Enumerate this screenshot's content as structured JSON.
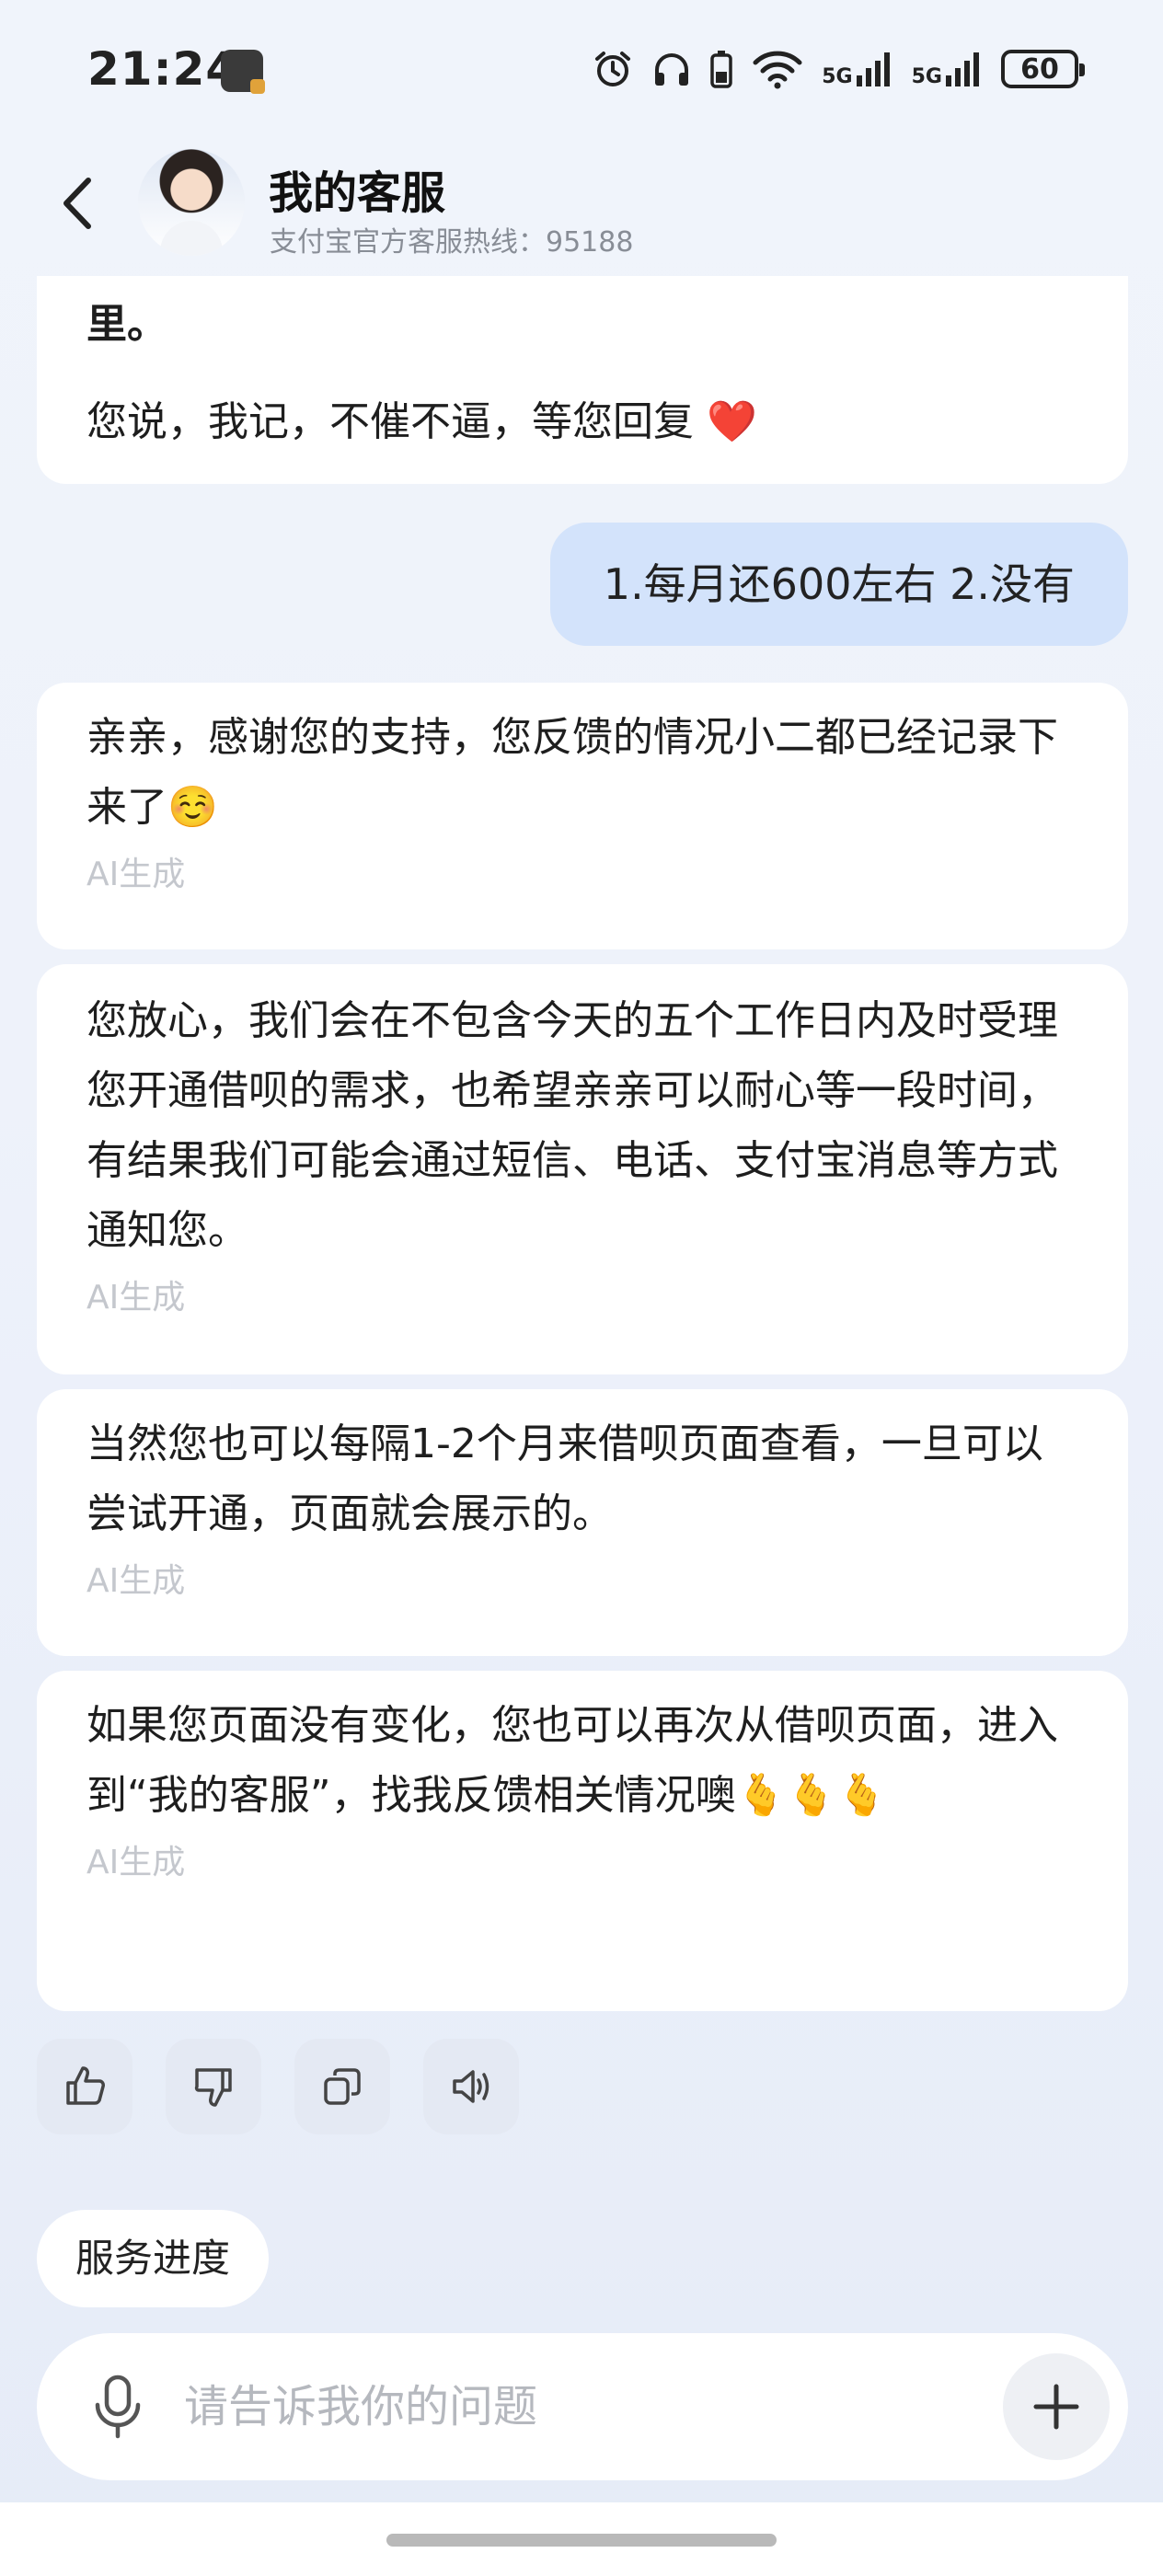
{
  "status_bar": {
    "time": "21:24",
    "network_1": "5G",
    "network_2": "5G",
    "battery": "60",
    "icons": [
      "alarm-icon",
      "headphones-icon",
      "battery-small-icon",
      "wifi-icon",
      "signal-icon"
    ]
  },
  "header": {
    "title": "我的客服",
    "subtitle": "支付宝官方客服热线：95188"
  },
  "messages": [
    {
      "role": "agent",
      "lines": [
        "里。",
        "您说，我记，不催不逼，等您回复 ❤️"
      ]
    },
    {
      "role": "user",
      "text": "1.每月还600左右  2.没有"
    },
    {
      "role": "agent",
      "text": "亲亲，感谢您的支持，您反馈的情况小二都已经记录下来了☺️",
      "tag": "AI生成"
    },
    {
      "role": "agent",
      "text": "您放心，我们会在不包含今天的五个工作日内及时受理您开通借呗的需求，也希望亲亲可以耐心等一段时间，有结果我们可能会通过短信、电话、支付宝消息等方式通知您。",
      "tag": "AI生成"
    },
    {
      "role": "agent",
      "text": "当然您也可以每隔1-2个月来借呗页面查看，一旦可以尝试开通，页面就会展示的。",
      "tag": "AI生成"
    },
    {
      "role": "agent",
      "text": "如果您页面没有变化，您也可以再次从借呗页面，进入到“我的客服”，找我反馈相关情况噢🫰🫰🫰",
      "tag": "AI生成"
    }
  ],
  "actions": [
    "thumbs-up-icon",
    "thumbs-down-icon",
    "copy-icon",
    "speaker-icon"
  ],
  "quick_chip": "服务进度",
  "input": {
    "placeholder": "请告诉我你的问题"
  }
}
